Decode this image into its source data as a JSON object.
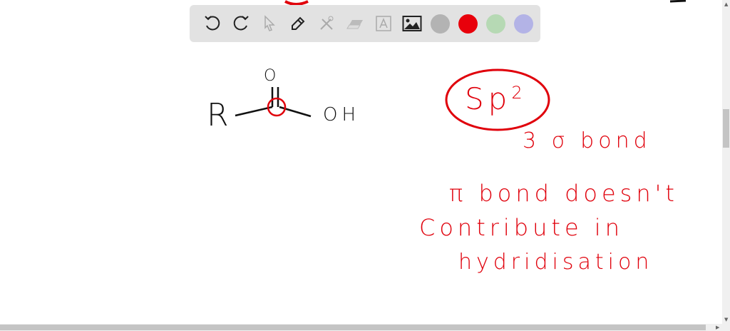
{
  "toolbar": {
    "tools": [
      "undo-icon",
      "redo-icon",
      "select-icon",
      "pen-icon",
      "tools-icon",
      "eraser-icon",
      "text-icon",
      "image-icon"
    ],
    "colors": [
      "#b3b3b3",
      "#e8000b",
      "#b6d9b4",
      "#b3b3e6"
    ]
  },
  "drawing": {
    "structure": {
      "r": "R",
      "o": "O",
      "oh": "OH"
    },
    "notes": {
      "hybrid": "Sp",
      "hybrid_sup": "2",
      "sigma": "3 σ bond",
      "line1": "π bond doesn't",
      "line2": "Contribute in",
      "line3": "hydridisation"
    }
  }
}
